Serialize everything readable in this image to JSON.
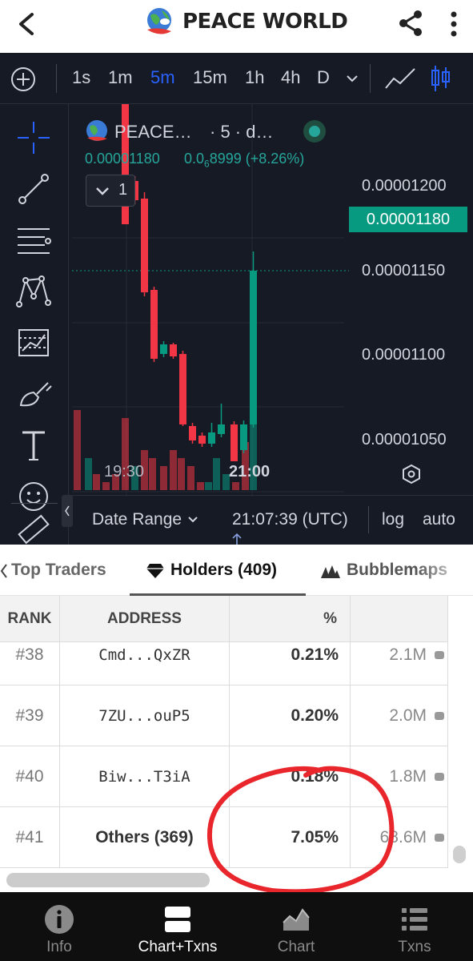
{
  "header": {
    "title": "PEACE WORLD"
  },
  "toolbar": {
    "timeframes": [
      "1s",
      "1m",
      "5m",
      "15m",
      "1h",
      "4h",
      "D"
    ],
    "active_timeframe": "5m"
  },
  "legend": {
    "symbol": "PEACE…",
    "interval": "· 5 · d…",
    "price": "0.00001180",
    "change_value": "0.0",
    "change_subscript": "6",
    "change_rest": "8999 (+8.26%)",
    "collapse_count": "1"
  },
  "chart_data": {
    "type": "candlestick",
    "y_axis_labels": [
      "0.00001200",
      "0.00001150",
      "0.00001100",
      "0.00001050"
    ],
    "current_price_label": "0.00001180",
    "x_axis_labels": [
      "19:30",
      "21:00"
    ],
    "up_color": "#089981",
    "down_color": "#f23645"
  },
  "bottom_bar": {
    "date_range": "Date Range",
    "time": "21:07:39 (UTC)",
    "log": "log",
    "auto": "auto"
  },
  "tabs": [
    {
      "label": "Top Traders"
    },
    {
      "label": "Holders (409)"
    },
    {
      "label": "Bubblemaps"
    }
  ],
  "table": {
    "headers": {
      "rank": "RANK",
      "address": "ADDRESS",
      "pct": "%"
    },
    "rows": [
      {
        "rank": "#38",
        "address": "Cmd...QxZR",
        "pct": "0.21%",
        "amount": "2.1M"
      },
      {
        "rank": "#39",
        "address": "7ZU...ouP5",
        "pct": "0.20%",
        "amount": "2.0M"
      },
      {
        "rank": "#40",
        "address": "Biw...T3iA",
        "pct": "0.18%",
        "amount": "1.8M"
      },
      {
        "rank": "#41",
        "address": "Others (369)",
        "pct": "7.05%",
        "amount": "68.6M"
      }
    ]
  },
  "nav": [
    {
      "label": "Info",
      "icon": "info-icon"
    },
    {
      "label": "Chart+Txns",
      "icon": "chart-txns-icon"
    },
    {
      "label": "Chart",
      "icon": "area-chart-icon"
    },
    {
      "label": "Txns",
      "icon": "list-icon"
    }
  ]
}
